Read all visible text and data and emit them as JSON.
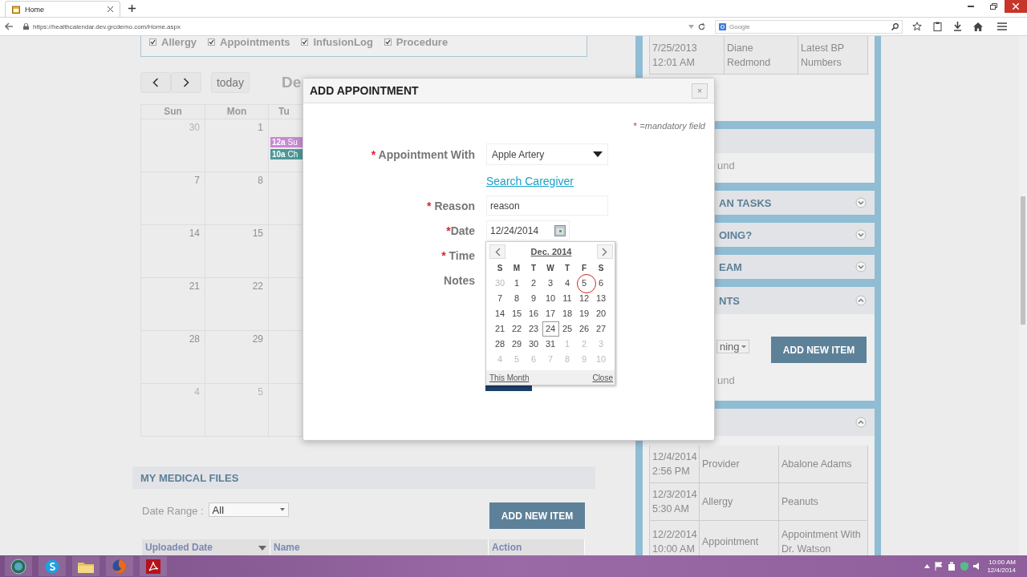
{
  "browser": {
    "tab": {
      "title": "Home"
    },
    "url": "https://healthcalendar.dev.grcdemo.com/Home.aspx",
    "search": {
      "placeholder": "Google"
    }
  },
  "filters": [
    {
      "label": "Allergy",
      "checked": true
    },
    {
      "label": "Appointments",
      "checked": true
    },
    {
      "label": "InfusionLog",
      "checked": true
    },
    {
      "label": "Procedure",
      "checked": true
    }
  ],
  "calendar": {
    "today": "today",
    "title": "De",
    "weekdays": [
      "Sun",
      "Mon",
      "Tu"
    ],
    "weeks": [
      {
        "days": [
          {
            "day": "30",
            "muted": true
          },
          {
            "day": "1",
            "muted": false
          }
        ],
        "tuesday_events": [
          {
            "time": "12a",
            "title": "Su",
            "color": "#c68bd2"
          },
          {
            "time": "10a",
            "title": "Ch",
            "color": "#4f9797"
          }
        ]
      },
      {
        "days": [
          {
            "day": "7",
            "muted": false
          },
          {
            "day": "8",
            "muted": false
          }
        ]
      },
      {
        "days": [
          {
            "day": "14",
            "muted": false
          },
          {
            "day": "15",
            "muted": false
          }
        ]
      },
      {
        "days": [
          {
            "day": "21",
            "muted": false
          },
          {
            "day": "22",
            "muted": false
          }
        ]
      },
      {
        "days": [
          {
            "day": "28",
            "muted": false
          },
          {
            "day": "29",
            "muted": false
          }
        ]
      },
      {
        "days": [
          {
            "day": "4",
            "muted": true
          },
          {
            "day": "5",
            "muted": true
          }
        ]
      }
    ]
  },
  "medical_files": {
    "title": "MY MEDICAL FILES",
    "date_range_label": "Date Range :",
    "date_range_value": "All",
    "add_button": "ADD NEW ITEM",
    "columns": [
      {
        "label": "Uploaded Date",
        "sorted": true
      },
      {
        "label": "Name",
        "sorted": false
      },
      {
        "label": "Action",
        "sorted": false
      }
    ]
  },
  "right_panel": {
    "top_rows": [
      {
        "cells": [
          "7/25/2013\n12:01 AM",
          "Diane\nRedmond",
          "Latest BP\nNumbers"
        ]
      }
    ],
    "sections": [
      {
        "message": "und"
      },
      {
        "title": "AN TASKS",
        "expanded": false
      },
      {
        "title": "OING?",
        "expanded": false
      },
      {
        "title": "EAM",
        "expanded": false
      },
      {
        "title": "NTS",
        "expanded": true,
        "filter_value": "ning",
        "add_button": "ADD NEW ITEM",
        "message": "und"
      },
      {
        "expanded": true,
        "rows": [
          {
            "cells": [
              "12/4/2014\n2:56 PM",
              "Provider",
              "Abalone Adams"
            ]
          },
          {
            "cells": [
              "12/3/2014\n5:30 AM",
              "Allergy",
              "Peanuts"
            ]
          },
          {
            "cells": [
              "12/2/2014\n10:00 AM",
              "Appointment",
              "Appointment With\nDr. Watson"
            ]
          }
        ]
      }
    ]
  },
  "modal": {
    "title": "ADD APPOINTMENT",
    "close": "×",
    "note_mark": "*",
    "note": "=mandatory field",
    "fields": [
      {
        "kind": "select",
        "mark": "*",
        "label": "Appointment With",
        "value": "Apple Artery"
      },
      {
        "kind": "link",
        "text": "Search Caregiver"
      },
      {
        "kind": "text",
        "mark": "*",
        "label": "Reason",
        "value": "reason"
      },
      {
        "kind": "date",
        "mark": "*",
        "label": "Date",
        "value": "12/24/2014"
      },
      {
        "kind": "covered",
        "mark": "*",
        "label": "Time"
      },
      {
        "kind": "covered",
        "label": "Notes"
      }
    ],
    "datepicker": {
      "month": "Dec. 2014",
      "weekdays": [
        "S",
        "M",
        "T",
        "W",
        "T",
        "F",
        "S"
      ],
      "weeks": [
        [
          {
            "day": "30",
            "muted": true,
            "selected": false,
            "pointer": false
          },
          {
            "day": "1",
            "muted": false,
            "selected": false,
            "pointer": false
          },
          {
            "day": "2",
            "muted": false,
            "selected": false,
            "pointer": false
          },
          {
            "day": "3",
            "muted": false,
            "selected": false,
            "pointer": false
          },
          {
            "day": "4",
            "muted": false,
            "selected": false,
            "pointer": false
          },
          {
            "day": "5",
            "muted": false,
            "selected": false,
            "pointer": true
          },
          {
            "day": "6",
            "muted": false,
            "selected": false,
            "pointer": false
          }
        ],
        [
          {
            "day": "7",
            "muted": false,
            "selected": false,
            "pointer": false
          },
          {
            "day": "8",
            "muted": false,
            "selected": false,
            "pointer": false
          },
          {
            "day": "9",
            "muted": false,
            "selected": false,
            "pointer": false
          },
          {
            "day": "10",
            "muted": false,
            "selected": false,
            "pointer": false
          },
          {
            "day": "11",
            "muted": false,
            "selected": false,
            "pointer": false
          },
          {
            "day": "12",
            "muted": false,
            "selected": false,
            "pointer": false
          },
          {
            "day": "13",
            "muted": false,
            "selected": false,
            "pointer": false
          }
        ],
        [
          {
            "day": "14",
            "muted": false,
            "selected": false,
            "pointer": false
          },
          {
            "day": "15",
            "muted": false,
            "selected": false,
            "pointer": false
          },
          {
            "day": "16",
            "muted": false,
            "selected": false,
            "pointer": false
          },
          {
            "day": "17",
            "muted": false,
            "selected": false,
            "pointer": false
          },
          {
            "day": "18",
            "muted": false,
            "selected": false,
            "pointer": false
          },
          {
            "day": "19",
            "muted": false,
            "selected": false,
            "pointer": false
          },
          {
            "day": "20",
            "muted": false,
            "selected": false,
            "pointer": false
          }
        ],
        [
          {
            "day": "21",
            "muted": false,
            "selected": false,
            "pointer": false
          },
          {
            "day": "22",
            "muted": false,
            "selected": false,
            "pointer": false
          },
          {
            "day": "23",
            "muted": false,
            "selected": false,
            "pointer": false
          },
          {
            "day": "24",
            "muted": false,
            "selected": true,
            "pointer": false
          },
          {
            "day": "25",
            "muted": false,
            "selected": false,
            "pointer": false
          },
          {
            "day": "26",
            "muted": false,
            "selected": false,
            "pointer": false
          },
          {
            "day": "27",
            "muted": false,
            "selected": false,
            "pointer": false
          }
        ],
        [
          {
            "day": "28",
            "muted": false,
            "selected": false,
            "pointer": false
          },
          {
            "day": "29",
            "muted": false,
            "selected": false,
            "pointer": false
          },
          {
            "day": "30",
            "muted": false,
            "selected": false,
            "pointer": false
          },
          {
            "day": "31",
            "muted": false,
            "selected": false,
            "pointer": false
          },
          {
            "day": "1",
            "muted": true,
            "selected": false,
            "pointer": false
          },
          {
            "day": "2",
            "muted": true,
            "selected": false,
            "pointer": false
          },
          {
            "day": "3",
            "muted": true,
            "selected": false,
            "pointer": false
          }
        ],
        [
          {
            "day": "4",
            "muted": true,
            "selected": false,
            "pointer": false
          },
          {
            "day": "5",
            "muted": true,
            "selected": false,
            "pointer": false
          },
          {
            "day": "6",
            "muted": true,
            "selected": false,
            "pointer": false
          },
          {
            "day": "7",
            "muted": true,
            "selected": false,
            "pointer": false
          },
          {
            "day": "8",
            "muted": true,
            "selected": false,
            "pointer": false
          },
          {
            "day": "9",
            "muted": true,
            "selected": false,
            "pointer": false
          },
          {
            "day": "10",
            "muted": true,
            "selected": false,
            "pointer": false
          }
        ]
      ],
      "this_month": "This Month",
      "close": "Close"
    }
  },
  "taskbar": {
    "time": "10:00 AM",
    "date": "12/4/2014"
  }
}
